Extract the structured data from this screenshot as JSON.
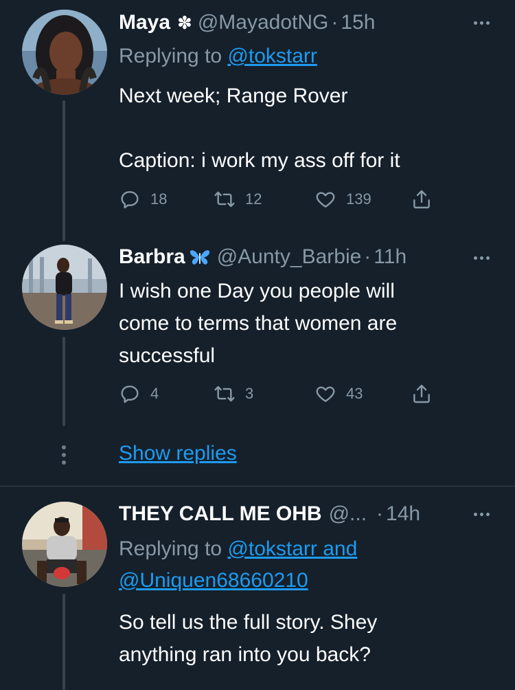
{
  "tweets": [
    {
      "name": "Maya",
      "badge": "✽",
      "handle": "@MayadotNG",
      "separator": "·",
      "time": "15h",
      "replying_prefix": "Replying to ",
      "replying_to": "@tokstarr",
      "lines": [
        "Next week; Range Rover",
        "",
        "Caption: i work my ass off for it"
      ],
      "replies": "18",
      "retweets": "12",
      "likes": "139"
    },
    {
      "name": "Barbra",
      "badge": "butterfly",
      "handle": "@Aunty_Barbie",
      "separator": "·",
      "time": "11h",
      "lines": [
        "I wish one Day you people will",
        "come to terms that women are",
        "successful"
      ],
      "replies": "4",
      "retweets": "3",
      "likes": "43"
    },
    {
      "name": "THEY CALL ME OHB",
      "handle": "@...",
      "separator": "·",
      "time": "14h",
      "replying_prefix": "Replying to ",
      "replying_to_1": "@tokstarr and",
      "replying_to_2": "@Uniquen68660210",
      "lines": [
        "So tell us the full story. Shey",
        "anything ran into you back?"
      ]
    }
  ],
  "show_replies": "Show replies",
  "colors": {
    "background": "#15202b",
    "secondary_text": "#8899a6",
    "link": "#1d9bf0",
    "butterfly": "#4aa8ff"
  },
  "icons": [
    "reply-icon",
    "retweet-icon",
    "like-icon",
    "share-icon",
    "more-icon"
  ]
}
